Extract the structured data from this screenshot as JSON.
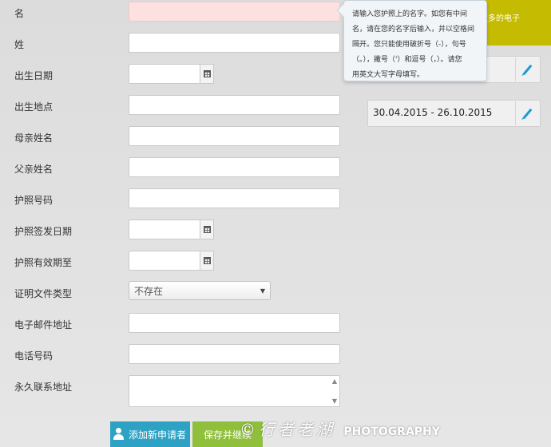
{
  "form": {
    "fields": [
      {
        "label": "名"
      },
      {
        "label": "姓"
      },
      {
        "label": "出生日期"
      },
      {
        "label": "出生地点"
      },
      {
        "label": "母亲姓名"
      },
      {
        "label": "父亲姓名"
      },
      {
        "label": "护照号码"
      },
      {
        "label": "护照签发日期"
      },
      {
        "label": "护照有效期至"
      },
      {
        "label": "证明文件类型",
        "value": "不存在"
      },
      {
        "label": "电子邮件地址"
      },
      {
        "label": "电话号码"
      },
      {
        "label": "永久联系地址"
      }
    ]
  },
  "tooltip": {
    "lines": [
      "请输入您护照上的名字。如您有中间",
      "名，请在您的名字后输入，并以空格间",
      "隔开。您只能使用破折号（-），句号",
      "（。），撇号（'）和逗号（，）。请您",
      "用英文大写字母填写。"
    ]
  },
  "sidebar": {
    "green_box_text": "更多的电子",
    "card1_text": "",
    "card2_text": "30.04.2015 - 26.10.2015"
  },
  "buttons": {
    "add_applicant": "添加新申请者",
    "save_continue": "保存并继续"
  },
  "watermark": {
    "text": "©行者老湖",
    "photo": "PHOTOGRAPHY"
  },
  "colors": {
    "accent_blue": "#2ea2c4",
    "accent_green": "#8fbf3b",
    "olive": "#c5bb00",
    "error_pink": "#fde1e1"
  }
}
